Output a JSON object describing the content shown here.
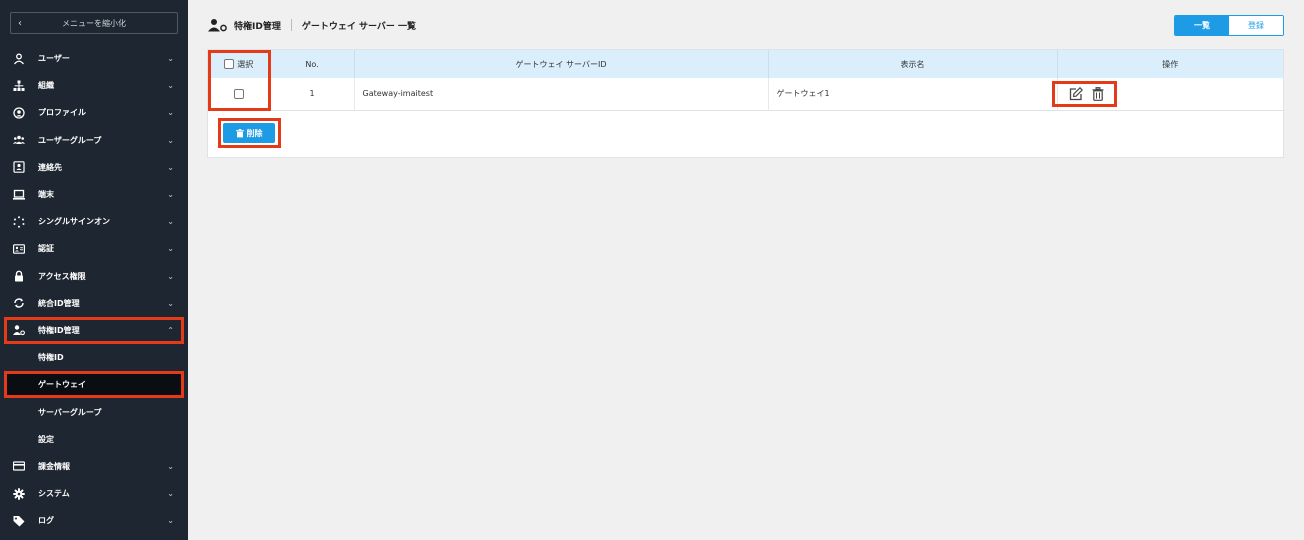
{
  "sidebar": {
    "collapse_label": "メニューを縮小化",
    "collapse_icon": "chevron-left-icon",
    "items": [
      {
        "label": "ユーザー",
        "icon": "user-icon",
        "arrow": "⌄"
      },
      {
        "label": "組織",
        "icon": "org-icon",
        "arrow": "⌄"
      },
      {
        "label": "プロファイル",
        "icon": "profile-icon",
        "arrow": "⌄"
      },
      {
        "label": "ユーザーグループ",
        "icon": "users-group-icon",
        "arrow": "⌄"
      },
      {
        "label": "連絡先",
        "icon": "contact-icon",
        "arrow": "⌄"
      },
      {
        "label": "端末",
        "icon": "laptop-icon",
        "arrow": "⌄"
      },
      {
        "label": "シングルサインオン",
        "icon": "sso-icon",
        "arrow": "⌄"
      },
      {
        "label": "認証",
        "icon": "id-card-icon",
        "arrow": "⌄"
      },
      {
        "label": "アクセス権限",
        "icon": "lock-icon",
        "arrow": "⌄"
      },
      {
        "label": "統合ID管理",
        "icon": "sync-icon",
        "arrow": "⌄"
      },
      {
        "label": "特権ID管理",
        "icon": "privileged-user-icon",
        "arrow": "⌃"
      }
    ],
    "sub_items": [
      {
        "label": "特権ID"
      },
      {
        "label": "ゲートウェイ"
      },
      {
        "label": "サーバーグループ"
      },
      {
        "label": "設定"
      }
    ],
    "bottom_items": [
      {
        "label": "課金情報",
        "icon": "billing-icon",
        "arrow": "⌄"
      },
      {
        "label": "システム",
        "icon": "gear-icon",
        "arrow": "⌄"
      },
      {
        "label": "ログ",
        "icon": "tag-icon",
        "arrow": "⌄"
      }
    ]
  },
  "header": {
    "section": "特権ID管理",
    "title": "ゲートウェイ サーバー 一覧"
  },
  "view_toggle": {
    "list_label": "一覧",
    "register_label": "登録"
  },
  "table": {
    "columns": [
      "選択",
      "No.",
      "ゲートウェイ サーバーID",
      "表示名",
      "操作"
    ],
    "rows": [
      {
        "no": "1",
        "id": "Gateway-imaitest",
        "name": "ゲートウェイ1"
      }
    ]
  },
  "actions": {
    "delete_label": "削除"
  },
  "colors": {
    "accent": "#1e9be5",
    "sidebar_bg": "#1e2731",
    "highlight": "#e53a17",
    "table_header": "#daeefb"
  }
}
